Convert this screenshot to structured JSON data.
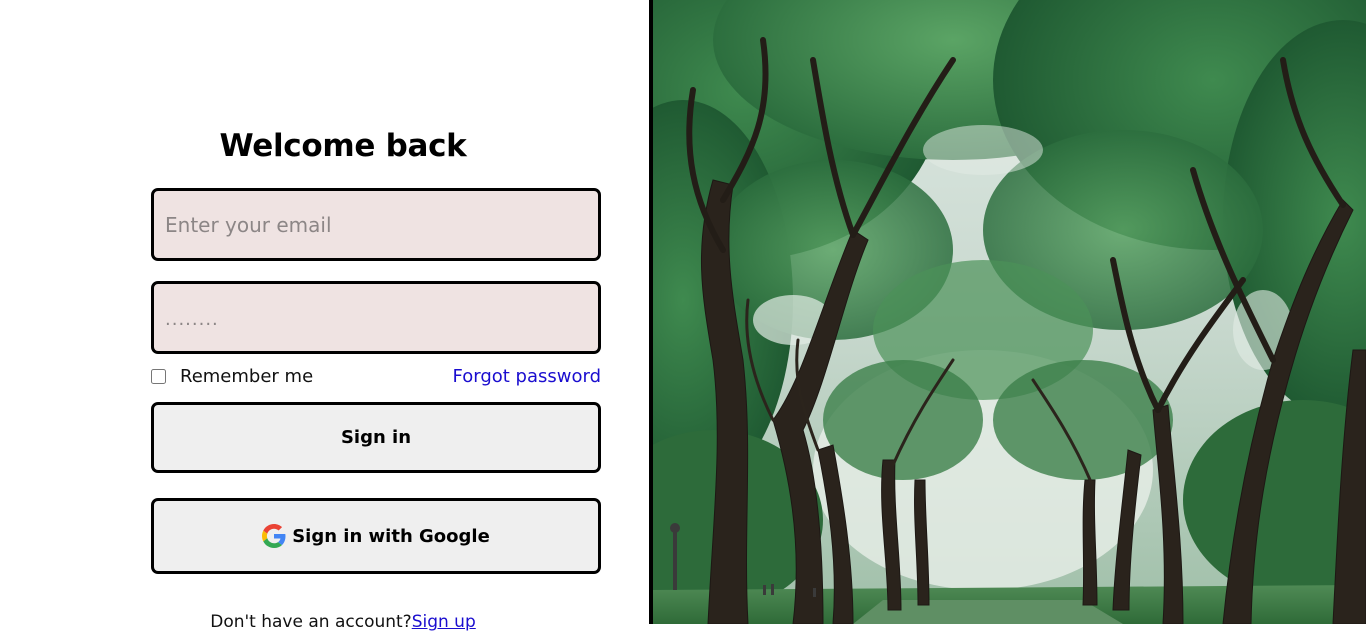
{
  "login": {
    "title": "Welcome back",
    "email_placeholder": "Enter your email",
    "password_placeholder": "........",
    "remember_label": "Remember me",
    "forgot_label": "Forgot password",
    "signin_label": "Sign in",
    "google_label": "Sign in with Google",
    "no_account_text": "Don't have an account?",
    "signup_label": "Sign up"
  },
  "icons": {
    "google": "google-icon"
  },
  "colors": {
    "input_bg": "#efe3e2",
    "button_bg": "#efefef",
    "link": "#1a0dcf",
    "border": "#000000"
  },
  "hero_image": {
    "subject": "tree-lined park path"
  }
}
